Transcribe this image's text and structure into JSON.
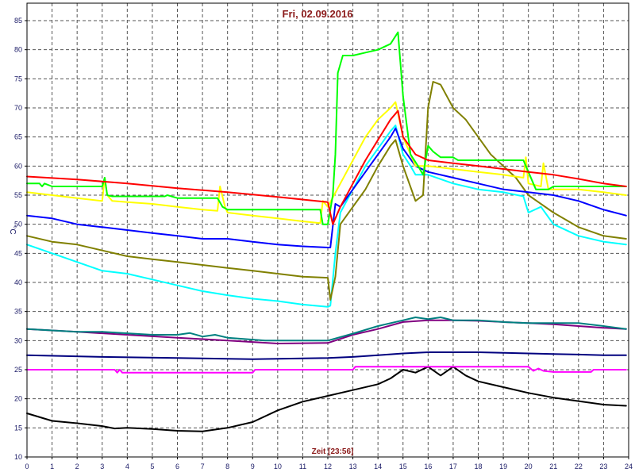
{
  "chart_data": {
    "type": "line",
    "title": "Fri, 02.09.2016",
    "xlabel": "Zeit [23:56]",
    "ylabel": "°C",
    "xlim": [
      0,
      24
    ],
    "ylim": [
      10,
      88
    ],
    "x_ticks": [
      0,
      1,
      2,
      3,
      4,
      5,
      6,
      7,
      8,
      9,
      10,
      11,
      12,
      13,
      14,
      15,
      16,
      17,
      18,
      19,
      20,
      21,
      22,
      23,
      24
    ],
    "y_ticks": [
      10,
      15,
      20,
      25,
      30,
      35,
      40,
      45,
      50,
      55,
      60,
      65,
      70,
      75,
      80,
      85
    ],
    "grid": true,
    "background": "#ffffff",
    "series": [
      {
        "color": "#000000",
        "x": [
          0,
          1,
          2,
          3,
          3.5,
          4,
          5,
          6,
          7,
          8,
          9,
          10,
          11,
          12,
          13,
          14,
          14.5,
          15,
          15.5,
          16,
          16.5,
          17,
          17.5,
          18,
          19,
          20,
          21,
          22,
          23,
          23.9
        ],
        "y": [
          17.5,
          16.2,
          15.8,
          15.3,
          14.9,
          15,
          14.8,
          14.5,
          14.4,
          15,
          16,
          18,
          19.5,
          20.5,
          21.5,
          22.5,
          23.5,
          25,
          24.5,
          25.5,
          24,
          25.5,
          24,
          23,
          22,
          21,
          20.2,
          19.6,
          19,
          18.8
        ]
      },
      {
        "color": "#ff00ff",
        "x": [
          0,
          3.5,
          3.6,
          3.7,
          3.8,
          4,
          9,
          9.1,
          10,
          13,
          13.1,
          20,
          20.2,
          20.4,
          20.6,
          21,
          22.5,
          22.6,
          23.9
        ],
        "y": [
          25,
          25,
          24.5,
          25,
          24.5,
          24.5,
          24.5,
          25,
          25,
          25,
          25.5,
          25.5,
          24.8,
          25.2,
          24.8,
          24.6,
          24.6,
          25,
          25
        ]
      },
      {
        "color": "#00007f",
        "x": [
          0,
          3,
          6,
          9,
          12,
          13,
          14,
          15,
          16,
          17,
          18,
          19,
          20,
          21,
          22,
          23,
          23.9
        ],
        "y": [
          27.5,
          27.2,
          27,
          26.8,
          27,
          27.2,
          27.5,
          27.8,
          28,
          28,
          28,
          27.9,
          27.8,
          27.7,
          27.6,
          27.5,
          27.5
        ]
      },
      {
        "color": "#800080",
        "x": [
          0,
          2,
          4,
          6,
          8,
          10,
          12,
          13,
          14,
          15,
          16,
          17,
          18,
          19,
          20,
          21,
          22,
          23,
          23.9
        ],
        "y": [
          32,
          31.5,
          31,
          30.5,
          30,
          29.5,
          29.6,
          31,
          32,
          33.2,
          33.5,
          33.5,
          33.4,
          33.2,
          33,
          32.8,
          32.5,
          32.2,
          32
        ]
      },
      {
        "color": "#008080",
        "x": [
          0,
          2,
          3,
          5,
          6,
          6.5,
          7,
          7.5,
          8,
          9.5,
          10,
          11,
          12,
          13,
          14,
          15,
          15.5,
          16,
          16.5,
          17,
          18,
          19,
          20,
          21,
          22,
          23,
          23.9
        ],
        "y": [
          32,
          31.5,
          31.5,
          31,
          31,
          31.3,
          30.7,
          31,
          30.5,
          30,
          30,
          30,
          30,
          31.2,
          32.5,
          33.5,
          34,
          33.7,
          34,
          33.5,
          33.5,
          33.2,
          33,
          33,
          33,
          32.5,
          32
        ]
      },
      {
        "color": "#00ffff",
        "x": [
          0,
          1,
          2,
          3,
          4,
          5,
          6,
          7,
          8,
          9,
          10,
          11,
          12,
          12.1,
          12.3,
          12.5,
          13,
          13.5,
          14,
          14.5,
          14.7,
          15,
          15.3,
          15.5,
          16,
          17,
          18,
          19,
          19.8,
          20,
          20.5,
          21,
          22,
          23,
          23.9
        ],
        "y": [
          46.5,
          45,
          43.5,
          42,
          41.5,
          40.5,
          39.5,
          38.5,
          37.8,
          37.2,
          36.8,
          36.2,
          35.8,
          36,
          45,
          52,
          56,
          60,
          63,
          66,
          67,
          62,
          60,
          58.5,
          58.5,
          57,
          56,
          55.5,
          54.8,
          52,
          53,
          50,
          48,
          47,
          46.5
        ]
      },
      {
        "color": "#808000",
        "x": [
          0,
          1,
          2,
          3,
          4,
          5,
          6,
          7,
          8,
          9,
          10,
          11,
          12,
          12.1,
          12.3,
          12.5,
          13,
          13.5,
          14,
          14.5,
          14.7,
          15,
          15.5,
          15.8,
          16,
          16.2,
          16.5,
          17,
          17.5,
          18,
          18.5,
          19,
          19.5,
          20,
          21,
          22,
          23,
          23.9
        ],
        "y": [
          48,
          47,
          46.5,
          45.5,
          44.5,
          44,
          43.5,
          43,
          42.5,
          42,
          41.5,
          41,
          40.8,
          37,
          41,
          50,
          53,
          56,
          60,
          63.5,
          64.5,
          60,
          54,
          55,
          70,
          74.5,
          74,
          70,
          68,
          65,
          62,
          60,
          58,
          55,
          52,
          49.5,
          48,
          47.5
        ]
      },
      {
        "color": "#0000ff",
        "x": [
          0,
          1,
          2,
          3,
          4,
          5,
          6,
          7,
          8,
          9,
          10,
          11,
          12,
          12.1,
          12.3,
          12.5,
          13,
          13.5,
          14,
          14.5,
          14.7,
          15,
          15.5,
          16,
          17,
          18,
          19,
          20,
          21,
          22,
          23,
          23.9
        ],
        "y": [
          51.5,
          51,
          50,
          49.5,
          49,
          48.5,
          48,
          47.5,
          47.5,
          47,
          46.5,
          46.2,
          46,
          46,
          53.5,
          53,
          56,
          59,
          62,
          65,
          66.5,
          63,
          60,
          59,
          58,
          57,
          56,
          55.5,
          55,
          54,
          52.5,
          51.5
        ]
      },
      {
        "color": "#ffff00",
        "x": [
          0,
          1,
          2,
          3,
          3.1,
          3.2,
          3.4,
          4,
          5,
          6,
          7,
          7.6,
          7.7,
          7.9,
          8,
          9,
          10,
          11,
          11.7,
          11.8,
          12,
          12.5,
          13,
          13.5,
          14,
          14.5,
          14.7,
          15,
          15.5,
          16,
          17,
          18,
          19,
          19.8,
          19.9,
          20,
          20.5,
          20.6,
          20.8,
          21,
          22,
          23,
          23.9
        ],
        "y": [
          55.5,
          55,
          54.5,
          54,
          58,
          55,
          54,
          53.8,
          53.5,
          53,
          52.5,
          52.3,
          56.5,
          53,
          52,
          51.5,
          51,
          50.5,
          50.2,
          54,
          53,
          57,
          61,
          65,
          68,
          70,
          71,
          65,
          60,
          60,
          59.5,
          59,
          58.5,
          58,
          61.5,
          57,
          56.5,
          60.5,
          56,
          56,
          56,
          55.5,
          55
        ]
      },
      {
        "color": "#00ff00",
        "x": [
          0,
          0.5,
          0.6,
          0.7,
          1,
          2,
          3,
          3.1,
          3.2,
          3.4,
          4,
          5,
          5.5,
          5.6,
          6,
          7,
          7.5,
          7.6,
          7.8,
          8,
          9,
          10,
          11,
          11.7,
          11.8,
          12,
          12.2,
          12.3,
          12.4,
          12.6,
          13,
          13.5,
          14,
          14.5,
          14.8,
          15,
          15.3,
          15.6,
          15.8,
          16,
          16.2,
          16.5,
          17,
          17.2,
          17.5,
          18,
          19,
          19.5,
          19.8,
          20,
          20.3,
          20.6,
          20.8,
          21,
          22,
          23,
          23.9
        ],
        "y": [
          57,
          57,
          56.5,
          57,
          56.5,
          56.5,
          56.5,
          58,
          55,
          54.8,
          54.8,
          54.8,
          54.8,
          55,
          54.5,
          54.5,
          54.5,
          54.5,
          53,
          52.5,
          52.5,
          52.5,
          52.5,
          52.5,
          50,
          50,
          55,
          62,
          76,
          79,
          79,
          79.5,
          80,
          81,
          83,
          72,
          62,
          60,
          58.5,
          63.5,
          62.5,
          61.5,
          61.5,
          61,
          61,
          61,
          61,
          61,
          61,
          59,
          56,
          56,
          56,
          56.5,
          56.5,
          56.5,
          56.5
        ]
      },
      {
        "color": "#ff0000",
        "x": [
          0,
          2,
          4,
          6,
          8,
          10,
          12,
          12.2,
          12.5,
          13,
          13.5,
          14,
          14.5,
          14.8,
          15,
          15.5,
          16,
          17,
          18,
          19,
          20,
          21,
          22,
          23,
          23.9
        ],
        "y": [
          58.2,
          57.7,
          57,
          56.2,
          55.5,
          54.7,
          53.8,
          50,
          53,
          57,
          61,
          64.5,
          68,
          69.5,
          65,
          62,
          61,
          60.5,
          60,
          59.5,
          59,
          58.5,
          57.8,
          57,
          56.5
        ]
      }
    ]
  }
}
